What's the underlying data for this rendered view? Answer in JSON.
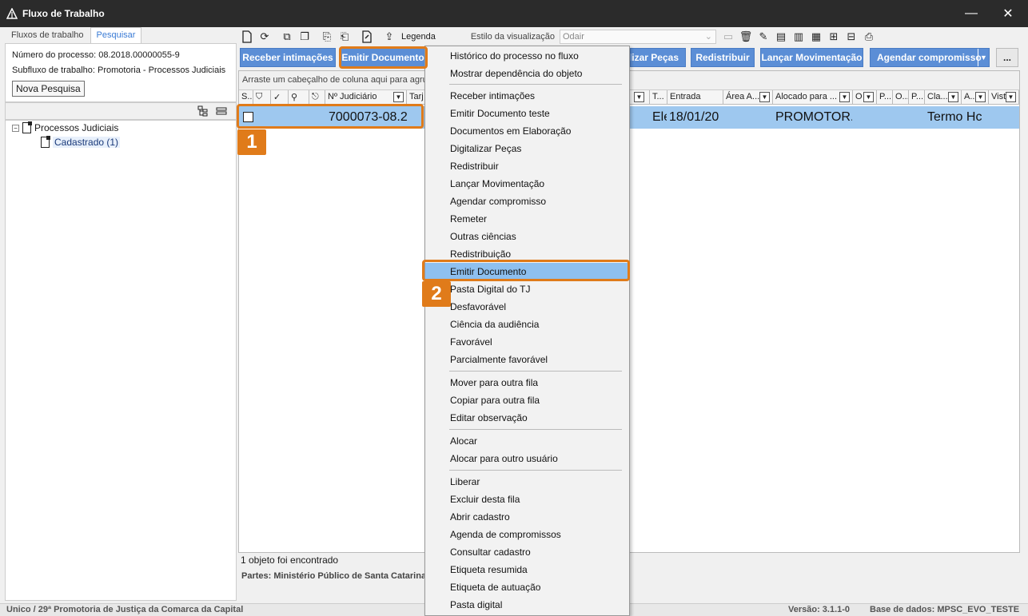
{
  "window": {
    "title": "Fluxo de Trabalho"
  },
  "left_tabs": [
    "Fluxos de trabalho",
    "Pesquisar"
  ],
  "info": {
    "process_number": "Número do processo: 08.2018.00000055-9",
    "subflow": "Subfluxo de trabalho: Promotoria - Processos Judiciais",
    "new_search": "Nova Pesquisa"
  },
  "tree": {
    "root": "Processos Judiciais",
    "child": "Cadastrado (1)"
  },
  "toolbar": {
    "legend": "Legenda",
    "view_style_label": "Estilo da visualização",
    "view_style_value": "Odair"
  },
  "actions": [
    "Receber intimações",
    "Emitir Documento",
    "Digitalizar Peças",
    "Redistribuir",
    "Lançar Movimentação",
    "Agendar compromisso",
    "..."
  ],
  "grid": {
    "group_hint": "Arraste um cabeçalho de coluna aqui para agrupar",
    "columns": [
      "S...",
      "Nº Judiciário",
      "Tarj",
      "T...",
      "Entrada",
      "Área A...",
      "Alocado para ...",
      "O",
      "P...",
      "O...",
      "P...",
      "Cla...",
      "A...",
      "Vista"
    ],
    "row": {
      "judicial_number": "7000073-08.2",
      "t": "Ele",
      "entrada": "18/01/20",
      "alocado": "PROMOTOR.T",
      "classe": "Termo Hc"
    }
  },
  "status": {
    "found": "1 objeto foi encontrado",
    "partes": "Partes: Ministério Público de Santa Catarina"
  },
  "statusbar": {
    "left": "Unico / 29ª Promotoria de Justiça da Comarca da Capital",
    "version": "Versão: 3.1.1-0",
    "database": "Base de dados: MPSC_EVO_TESTE"
  },
  "menu": {
    "items": [
      "Histórico do processo no fluxo",
      "Mostrar dependência do objeto",
      "Receber intimações",
      "Emitir Documento teste",
      "Documentos em Elaboração",
      "Digitalizar Peças",
      "Redistribuir",
      "Lançar Movimentação",
      "Agendar compromisso",
      "Remeter",
      "Outras ciências",
      "Redistribuição",
      "Emitir Documento",
      "Pasta Digital do TJ",
      "Desfavorável",
      "Ciência da audiência",
      "Favorável",
      "Parcialmente favorável",
      "Mover para outra fila",
      "Copiar para outra fila",
      "Editar observação",
      "Alocar",
      "Alocar para outro usuário",
      "Liberar",
      "Excluir desta fila",
      "Abrir cadastro",
      "Agenda de compromissos",
      "Consultar cadastro",
      "Etiqueta resumida",
      "Etiqueta de autuação",
      "Pasta digital"
    ]
  },
  "badges": [
    "1",
    "2"
  ],
  "colors": {
    "accent": "#5b8ed6",
    "callout": "#e07b1a",
    "selection": "#9ec8ef"
  }
}
